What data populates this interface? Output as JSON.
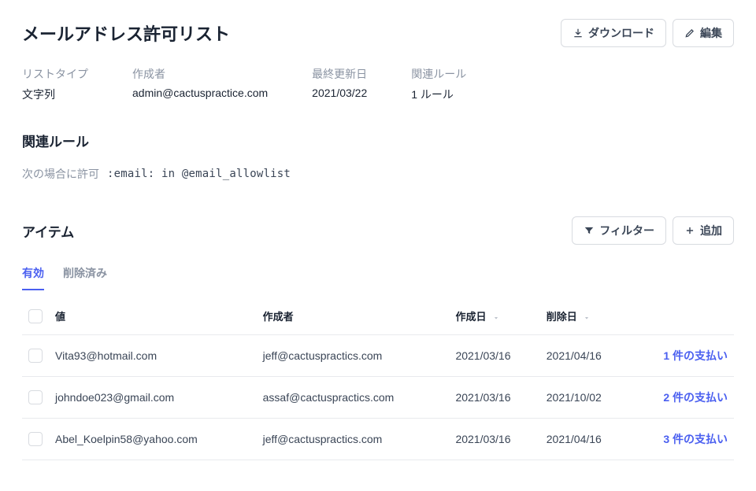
{
  "header": {
    "title": "メールアドレス許可リスト",
    "download_label": "ダウンロード",
    "edit_label": "編集"
  },
  "meta": {
    "list_type_label": "リストタイプ",
    "list_type_value": "文字列",
    "creator_label": "作成者",
    "creator_value": "admin@cactuspractice.com",
    "updated_label": "最終更新日",
    "updated_value": "2021/03/22",
    "rules_label": "関連ルール",
    "rules_value": "1 ルール"
  },
  "rules_section": {
    "title": "関連ルール",
    "prefix": "次の場合に許可",
    "code": ":email: in @email_allowlist"
  },
  "items_section": {
    "title": "アイテム",
    "filter_label": "フィルター",
    "add_label": "追加"
  },
  "tabs": {
    "active": "有効",
    "removed": "削除済み"
  },
  "table": {
    "headers": {
      "value": "値",
      "creator": "作成者",
      "created": "作成日",
      "removed": "削除日"
    },
    "rows": [
      {
        "value": "Vita93@hotmail.com",
        "creator": "jeff@cactuspractics.com",
        "created": "2021/03/16",
        "removed": "2021/04/16",
        "payments": "1 件の支払い"
      },
      {
        "value": "johndoe023@gmail.com",
        "creator": "assaf@cactuspractics.com",
        "created": "2021/03/16",
        "removed": "2021/10/02",
        "payments": "2 件の支払い"
      },
      {
        "value": "Abel_Koelpin58@yahoo.com",
        "creator": "jeff@cactuspractics.com",
        "created": "2021/03/16",
        "removed": "2021/04/16",
        "payments": "3 件の支払い"
      }
    ]
  }
}
